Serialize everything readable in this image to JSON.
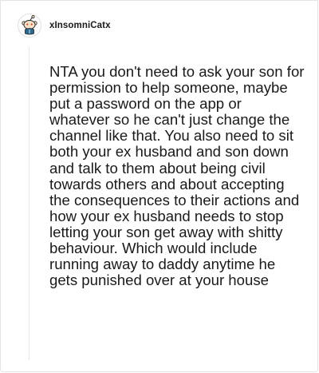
{
  "comment": {
    "author": "xInsomniCatx",
    "avatar_icon": "reddit-snoo-avatar-icon",
    "body": "NTA you don't need to ask your son for permission to help someone, maybe put a password on the app or whatever so he can't just change the channel like that. You also need to sit both your ex husband and son down and talk to them about being civil towards others and about accepting the consequences to their actions and how your ex husband needs to stop letting your son get away with shitty behaviour. Which would include running away to daddy anytime he gets punished over at your house"
  },
  "colors": {
    "text": "#1a1a1b",
    "thread_line": "#e6e6e6",
    "avatar_skin": "#f4e2c8",
    "avatar_accent": "#2a6a8f"
  }
}
